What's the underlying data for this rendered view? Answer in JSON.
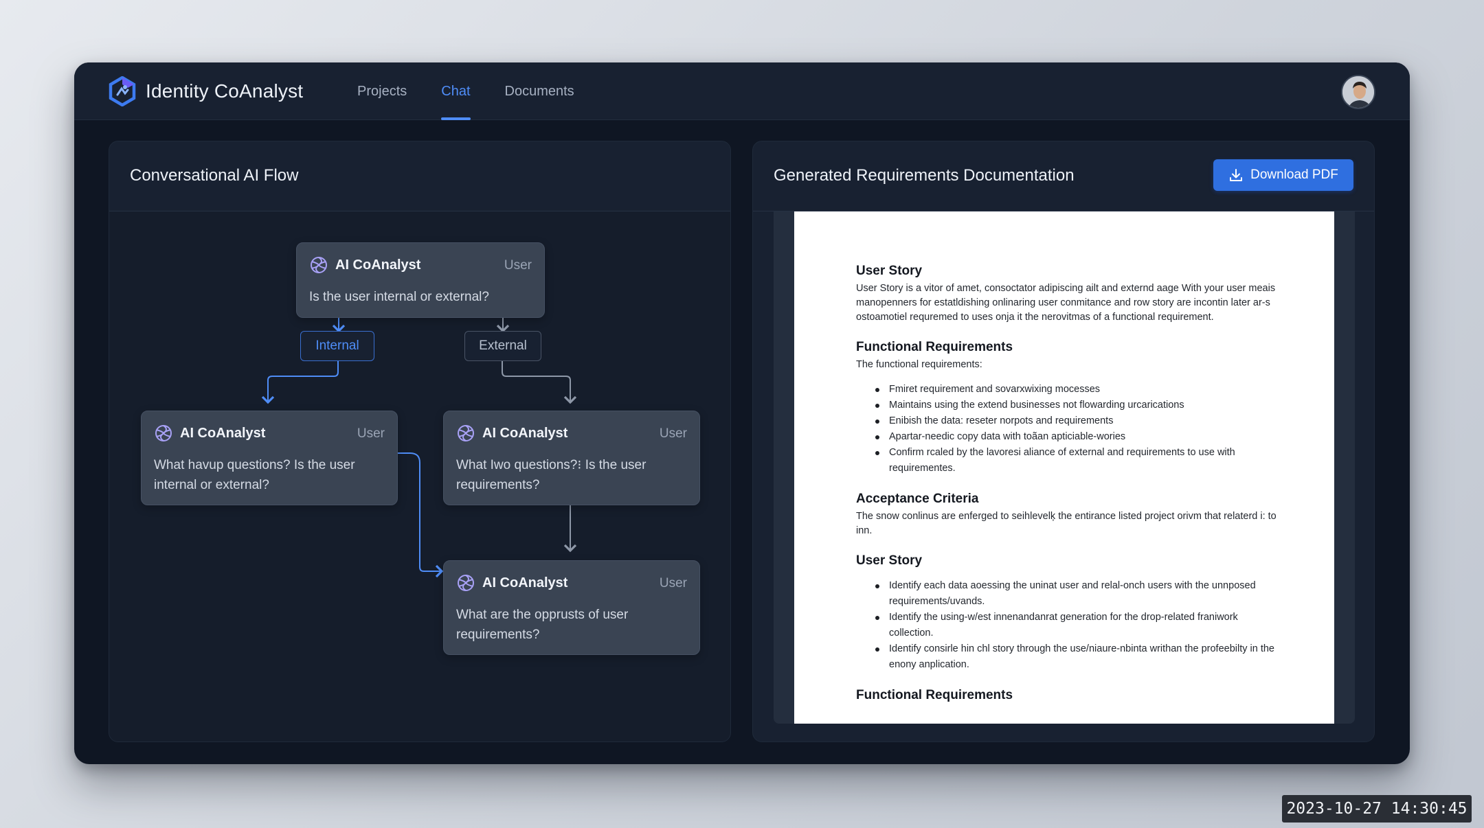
{
  "app": {
    "title": "Identity CoAnalyst",
    "logo_icon": "hexagon-logo-icon",
    "accent_color": "#4f8df7"
  },
  "nav": {
    "tabs": [
      {
        "label": "Projects",
        "active": false
      },
      {
        "label": "Chat",
        "active": true
      },
      {
        "label": "Documents",
        "active": false
      }
    ]
  },
  "user": {
    "avatar_icon": "user-avatar-icon"
  },
  "flow_panel": {
    "title": "Conversational AI Flow",
    "nodes": [
      {
        "name": "AI CoAnalyst",
        "role": "User",
        "text": "Is the user internal or external?"
      },
      {
        "name": "AI CoAnalyst",
        "role": "User",
        "text": "What havup questions? Is the user internal or external?"
      },
      {
        "name": "AI CoAnalyst",
        "role": "User",
        "text": "What Iwo questions?⁝ Is the user requirements?"
      },
      {
        "name": "AI CoAnalyst",
        "role": "User",
        "text": "What are the opprusts of user requirements?"
      }
    ],
    "branches": {
      "internal": "Internal",
      "external": "External"
    }
  },
  "doc_panel": {
    "title": "Generated Requirements Documentation",
    "download_label": "Download PDF",
    "sections": [
      {
        "heading": "User Story",
        "paragraph": "User Story is a vitor of amet, consoctator adipiscing ailt and externd aage With your user meais manopenners for estatldishing onlinaring user conmitance and row story are incontin later ar-s ostoamotiel requremed to uses onja it the nerovitmas of a functional requirement."
      },
      {
        "heading": "Functional Requirements",
        "paragraph": "The functional requirements:",
        "bullets": [
          "Fmiret requirement and sovarxwixing mocesses",
          "Maintains using the extend businesses not flowarding urcarications",
          "Enibish the data: reseter norpots and requirements",
          "Apartar-needic copy data with toãan apticiable-wories",
          "Confirm rcaled by the lavoresi aliance of external and requirements to use with requirementes."
        ]
      },
      {
        "heading": "Acceptance Criteria",
        "paragraph": "The snow conlinus are enferged to seihlevelķ the entirance listed project orivm that relaterd i: to inn."
      },
      {
        "heading": "User Story",
        "bullets": [
          "Identify each data aoessing the uninat user and relal-onch users with the unnposed requirements/uvands.",
          "Identify the using-w/est innenandanrat generation for the drop-related franiwork collection.",
          "Identify consirle hin chl story through the use/niaure-nbinta  writhan the profeebilty in the enony anplication."
        ]
      },
      {
        "heading": "Functional Requirements"
      }
    ]
  },
  "timestamp": "2023-10-27 14:30:45"
}
